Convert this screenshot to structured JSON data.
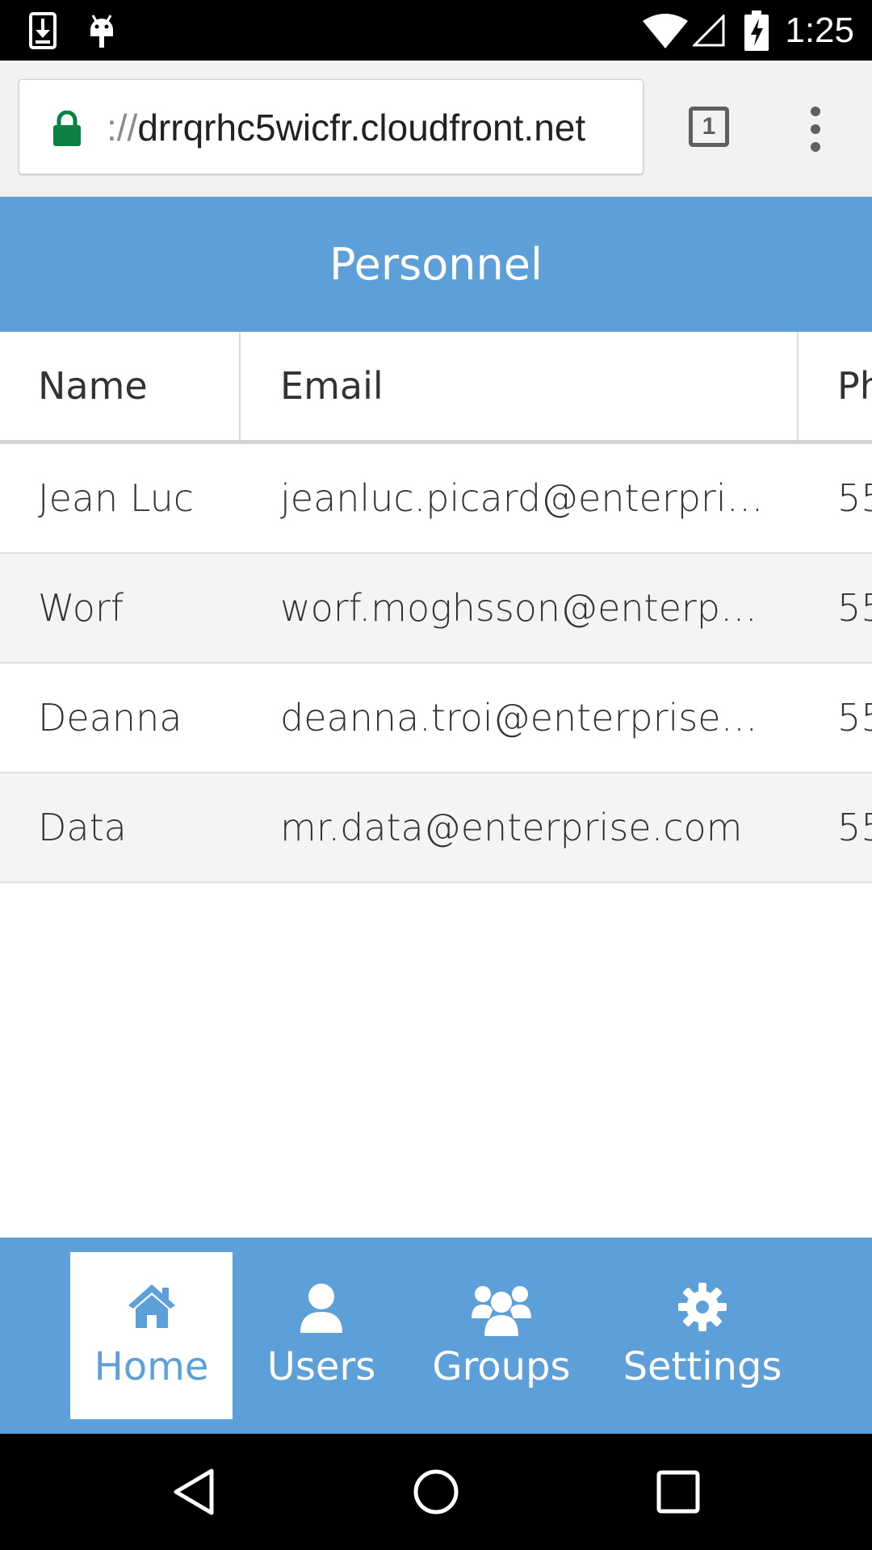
{
  "status_bar": {
    "time": "1:25",
    "icons": [
      "download-notification-icon",
      "android-debug-icon",
      "wifi-icon",
      "signal-icon",
      "battery-charging-icon"
    ]
  },
  "browser": {
    "url_scheme": "://",
    "url_host": "drrqrhc5wicfr.cloudfront.net",
    "tab_count": "1",
    "secure_color": "#0b8043"
  },
  "app": {
    "title": "Personnel",
    "accent_color": "#5d9fd9"
  },
  "table": {
    "columns": [
      "Name",
      "Email",
      "Ph"
    ],
    "rows": [
      {
        "name": "Jean Luc",
        "email": "jeanluc.picard@enterprise...",
        "phone": "55"
      },
      {
        "name": "Worf",
        "email": "worf.moghsson@enterpris...",
        "phone": "55"
      },
      {
        "name": "Deanna",
        "email": "deanna.troi@enterprise.co...",
        "phone": "55"
      },
      {
        "name": "Data",
        "email": "mr.data@enterprise.com",
        "phone": "55"
      }
    ]
  },
  "tabbar": {
    "tabs": [
      {
        "label": "Home",
        "icon": "home-icon",
        "active": true
      },
      {
        "label": "Users",
        "icon": "user-icon",
        "active": false
      },
      {
        "label": "Groups",
        "icon": "group-icon",
        "active": false
      },
      {
        "label": "Settings",
        "icon": "gear-icon",
        "active": false
      }
    ]
  }
}
